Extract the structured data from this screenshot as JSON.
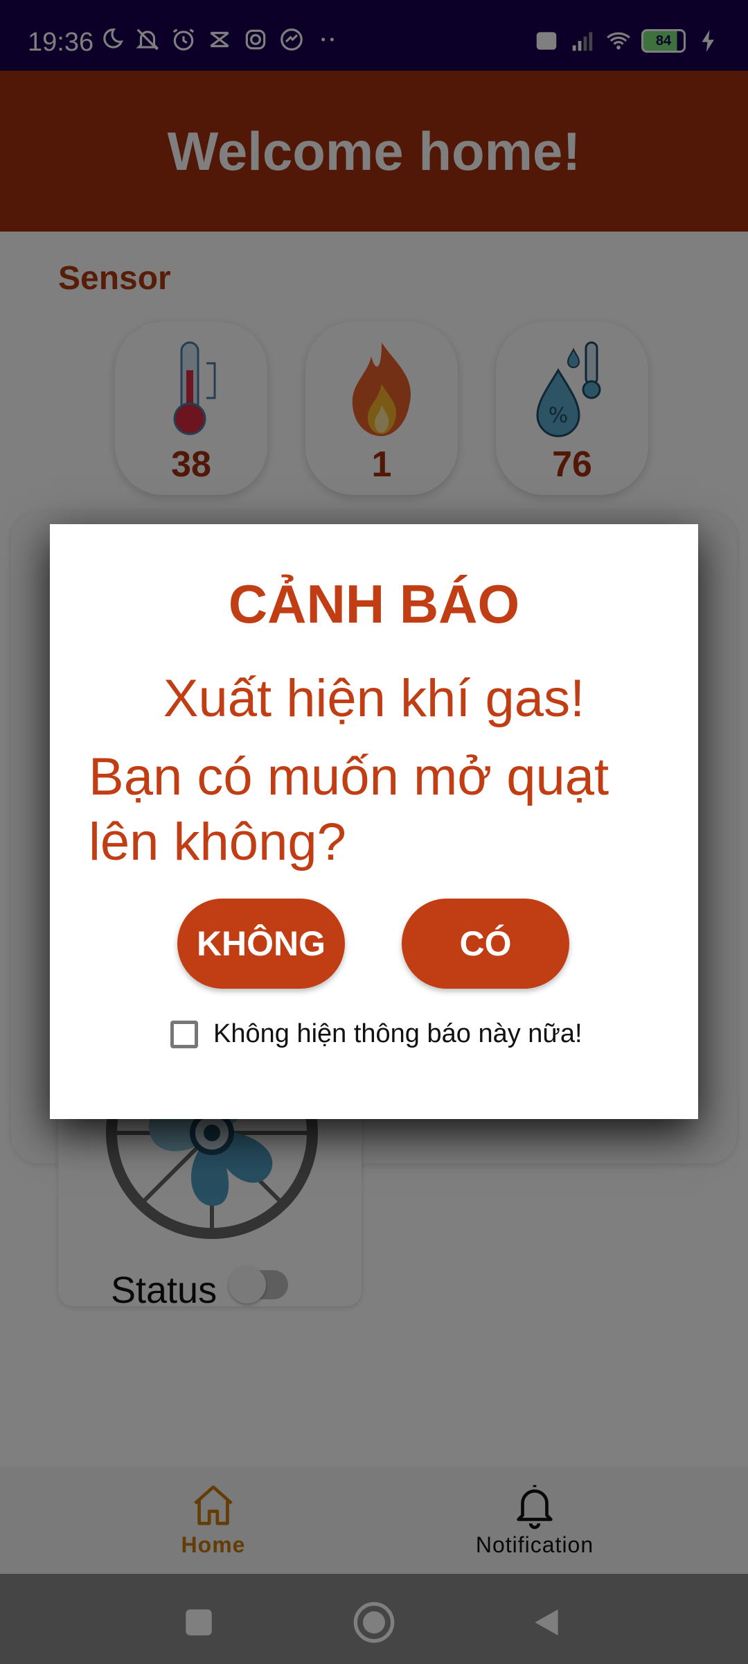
{
  "status_bar": {
    "time": "19:36",
    "battery": "84",
    "network": "VoLTE"
  },
  "header": {
    "title": "Welcome home!"
  },
  "sensor": {
    "label": "Sensor",
    "items": [
      {
        "icon": "thermometer-icon",
        "value": "38"
      },
      {
        "icon": "flame-icon",
        "value": "1"
      },
      {
        "icon": "humidity-icon",
        "value": "76"
      }
    ]
  },
  "fan": {
    "status_label": "Status",
    "status_on": false
  },
  "dialog": {
    "title": "CẢNH BÁO",
    "message_line1": "Xuất hiện khí gas!",
    "message_line2": "Bạn có muốn mở quạt lên không?",
    "no_label": "KHÔNG",
    "yes_label": "CÓ",
    "checkbox_label": "Không hiện thông báo này nữa!",
    "checkbox_checked": false
  },
  "bottom_nav": {
    "items": [
      {
        "label": "Home",
        "active": true
      },
      {
        "label": "Notification",
        "active": false
      }
    ]
  },
  "colors": {
    "primary": "#a32e0e",
    "dialog_accent": "#c13d13",
    "nav_active": "#c8780a",
    "status_bar": "#1a0050"
  }
}
